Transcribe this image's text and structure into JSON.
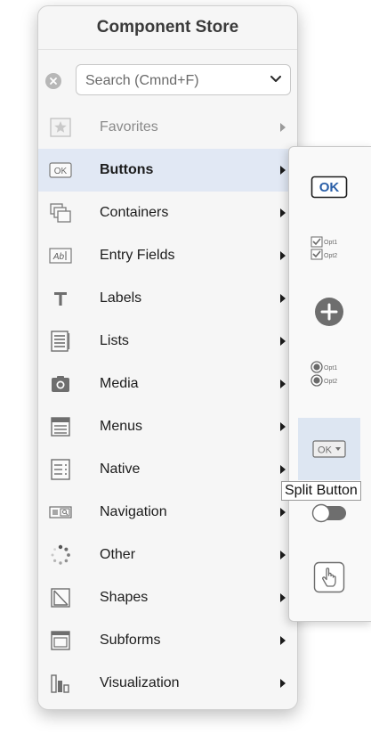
{
  "panel": {
    "title": "Component Store",
    "search": {
      "placeholder": "Search (Cmnd+F)"
    },
    "items": [
      {
        "label": "Favorites",
        "icon": "star-icon",
        "disabled": true
      },
      {
        "label": "Buttons",
        "icon": "ok-button-icon",
        "selected": true
      },
      {
        "label": "Containers",
        "icon": "containers-icon"
      },
      {
        "label": "Entry Fields",
        "icon": "entry-field-icon"
      },
      {
        "label": "Labels",
        "icon": "label-t-icon"
      },
      {
        "label": "Lists",
        "icon": "list-icon"
      },
      {
        "label": "Media",
        "icon": "camera-icon"
      },
      {
        "label": "Menus",
        "icon": "menu-icon"
      },
      {
        "label": "Native",
        "icon": "native-icon"
      },
      {
        "label": "Navigation",
        "icon": "navigation-icon"
      },
      {
        "label": "Other",
        "icon": "spinner-icon"
      },
      {
        "label": "Shapes",
        "icon": "shapes-icon"
      },
      {
        "label": "Subforms",
        "icon": "subform-icon"
      },
      {
        "label": "Visualization",
        "icon": "bar-chart-icon"
      }
    ]
  },
  "submenu": {
    "items": [
      {
        "name": "ok-button",
        "icon": "ok-button-icon",
        "text": "OK"
      },
      {
        "name": "checkbox-group",
        "icon": "checkbox-icon",
        "options": [
          "Opt1",
          "Opt2"
        ]
      },
      {
        "name": "round-plus-button",
        "icon": "plus-circle-icon"
      },
      {
        "name": "radio-group",
        "icon": "radio-icon",
        "options": [
          "Opt1",
          "Opt2"
        ]
      },
      {
        "name": "split-button",
        "icon": "split-button-icon",
        "text": "OK",
        "hovered": true
      },
      {
        "name": "toggle-switch",
        "icon": "toggle-icon"
      },
      {
        "name": "touch-button",
        "icon": "hand-pointer-icon"
      }
    ],
    "tooltip": "Split Button"
  },
  "colors": {
    "panel_bg": "#f6f6f6",
    "selected_bg": "#e1e8f4",
    "accent": "#2a5fa8",
    "icon_gray": "#7a7a7a"
  }
}
